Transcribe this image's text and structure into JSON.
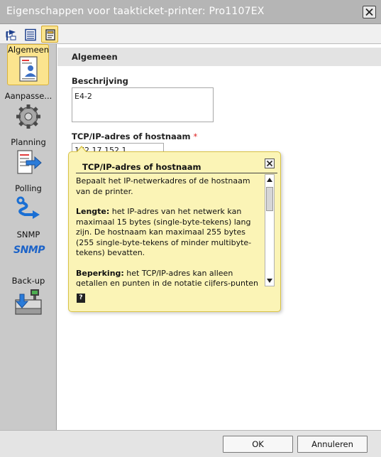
{
  "window": {
    "title": "Eigenschappen voor taakticket-printer: Pro1107EX"
  },
  "toolbar": {
    "buttons": [
      {
        "icon": "flag-icon"
      },
      {
        "icon": "list-icon"
      },
      {
        "icon": "note-icon",
        "active": true
      }
    ]
  },
  "sidebar": {
    "items": [
      {
        "label": "Algemeen",
        "icon": "document-user-icon",
        "selected": true
      },
      {
        "label": "Aanpasse...",
        "icon": "gear-icon"
      },
      {
        "label": "Planning",
        "icon": "schedule-arrow-icon"
      },
      {
        "label": "Polling",
        "icon": "polling-arrow-icon"
      },
      {
        "label": "SNMP",
        "icon": "snmp-icon",
        "icon_text": "SNMP"
      },
      {
        "label": "Back-up",
        "icon": "backup-icon"
      }
    ]
  },
  "main": {
    "section_title": "Algemeen",
    "description_label": "Beschrijving",
    "description_value": "E4-2",
    "ip_label": "TCP/IP-adres of hostnaam",
    "ip_required_mark": "*",
    "ip_value": "172.17.152.1"
  },
  "tooltip": {
    "title": "TCP/IP-adres of hostnaam",
    "intro": "Bepaalt het IP-netwerkadres of de hostnaam van de printer.",
    "length_heading": "Lengte:",
    "length_text": " het IP-adres van het netwerk kan maximaal 15 bytes (single-byte-tekens) lang zijn. De hostnaam kan maximaal 255 bytes (255 single-byte-tekens of minder multibyte-tekens) bevatten.",
    "restriction_heading": "Beperking:",
    "restriction_text": " het TCP/IP-adres kan alleen getallen en punten in de notatie cijfers-punten bevatten.",
    "help_icon_text": "?"
  },
  "footer": {
    "ok_label": "OK",
    "cancel_label": "Annuleren"
  },
  "colors": {
    "title_bar": "#b5b5b5",
    "sidebar": "#c9c9c9",
    "selection": "#fbe48e",
    "tooltip": "#fbf4b6",
    "required": "#d22222",
    "snmp_blue": "#1c63c8"
  }
}
